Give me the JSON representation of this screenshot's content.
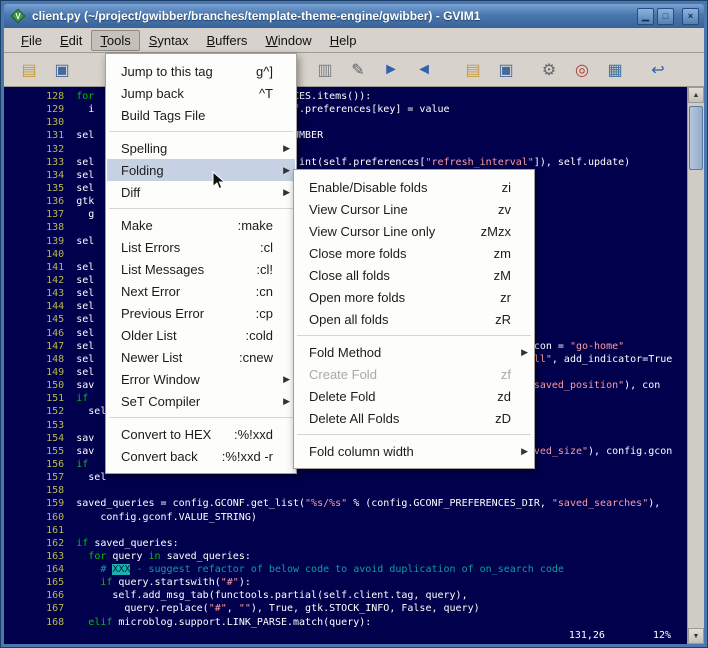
{
  "window": {
    "title": "client.py (~/project/gwibber/branches/template-theme-engine/gwibber) - GVIM1",
    "controls": [
      {
        "name": "minimize-button",
        "glyph": "▁"
      },
      {
        "name": "maximize-button",
        "glyph": "□"
      },
      {
        "name": "close-button",
        "glyph": "×"
      }
    ]
  },
  "colors": {
    "titlebar": "#4a78ae",
    "chrome": "#d7d3cc",
    "editor_bg": "#00004d",
    "normal_text": "#ffffff",
    "keyword": "#00c000",
    "string": "#ff9d9d",
    "comment": "#0e9e9e",
    "line_number": "#b9b94d",
    "xxx_highlight_bg": "#18b2b2",
    "menu_highlight": "#c6d2e4"
  },
  "menubar": {
    "items": [
      {
        "label": "File"
      },
      {
        "label": "Edit"
      },
      {
        "label": "Tools",
        "active": true
      },
      {
        "label": "Syntax"
      },
      {
        "label": "Buffers"
      },
      {
        "label": "Window"
      },
      {
        "label": "Help"
      }
    ]
  },
  "toolbar": {
    "buttons": [
      {
        "name": "open-file-icon",
        "glyph": "▤",
        "color": "#c79a3a"
      },
      {
        "name": "save-file-icon",
        "glyph": "▣",
        "color": "#46699c"
      },
      {
        "spacer": 230
      },
      {
        "name": "paste-icon",
        "glyph": "▥",
        "color": "#7a7f86"
      },
      {
        "name": "find-replace-icon",
        "glyph": "✎",
        "color": "#5b5f66"
      },
      {
        "name": "find-next-icon",
        "glyph": "►",
        "color": "#2f62ad"
      },
      {
        "name": "find-prev-icon",
        "glyph": "◄",
        "color": "#2f62ad"
      },
      {
        "spacer": 16
      },
      {
        "name": "load-session-icon",
        "glyph": "▤",
        "color": "#c79a3a"
      },
      {
        "name": "save-session-icon",
        "glyph": "▣",
        "color": "#46699c"
      },
      {
        "spacer": 10
      },
      {
        "name": "run-script-icon",
        "glyph": "⚙",
        "color": "#61666d"
      },
      {
        "name": "build-tags-icon",
        "glyph": "◎",
        "color": "#b23b2e"
      },
      {
        "name": "tag-jump-icon",
        "glyph": "▦",
        "color": "#3a6fa0"
      },
      {
        "spacer": 10
      },
      {
        "name": "help-icon",
        "glyph": "↩",
        "color": "#2f62ad"
      }
    ]
  },
  "menus": {
    "tools": {
      "items": [
        {
          "label": "Jump to this tag",
          "shortcut": "g^]"
        },
        {
          "label": "Jump back",
          "shortcut": "^T"
        },
        {
          "label": "Build Tags File"
        },
        {
          "sep": true
        },
        {
          "label": "Spelling",
          "submenu": true
        },
        {
          "label": "Folding",
          "submenu": true,
          "highlight": true
        },
        {
          "label": "Diff",
          "submenu": true
        },
        {
          "sep": true
        },
        {
          "label": "Make",
          "shortcut": ":make"
        },
        {
          "label": "List Errors",
          "shortcut": ":cl"
        },
        {
          "label": "List Messages",
          "shortcut": ":cl!"
        },
        {
          "label": "Next Error",
          "shortcut": ":cn"
        },
        {
          "label": "Previous Error",
          "shortcut": ":cp"
        },
        {
          "label": "Older List",
          "shortcut": ":cold"
        },
        {
          "label": "Newer List",
          "shortcut": ":cnew"
        },
        {
          "label": "Error Window",
          "submenu": true
        },
        {
          "label": "SeT Compiler",
          "submenu": true
        },
        {
          "sep": true
        },
        {
          "label": "Convert to HEX",
          "shortcut": ":%!xxd"
        },
        {
          "label": "Convert back",
          "shortcut": ":%!xxd -r"
        }
      ]
    },
    "folding": {
      "items": [
        {
          "label": "Enable/Disable folds",
          "shortcut": "zi"
        },
        {
          "label": "View Cursor Line",
          "shortcut": "zv"
        },
        {
          "label": "View Cursor Line only",
          "shortcut": "zMzx"
        },
        {
          "label": "Close more folds",
          "shortcut": "zm"
        },
        {
          "label": "Close all folds",
          "shortcut": "zM"
        },
        {
          "label": "Open more folds",
          "shortcut": "zr"
        },
        {
          "label": "Open all folds",
          "shortcut": "zR"
        },
        {
          "sep": true
        },
        {
          "label": "Fold Method",
          "submenu": true
        },
        {
          "label": "Create Fold",
          "shortcut": "zf",
          "disabled": true
        },
        {
          "label": "Delete Fold",
          "shortcut": "zd"
        },
        {
          "label": "Delete All Folds",
          "shortcut": "zD"
        },
        {
          "sep": true
        },
        {
          "label": "Fold column width",
          "submenu": true
        }
      ]
    }
  },
  "scrollbar": {
    "up": "▲",
    "down": "▼"
  },
  "editor": {
    "ruler": {
      "position": "131,26",
      "percent": "12%"
    },
    "lines": [
      {
        "num": 128,
        "segs": [
          {
            "c": "k",
            "t": "for"
          },
          {
            "c": "n",
            "t": "NCES.items()):",
            "col": 35
          }
        ]
      },
      {
        "num": 129,
        "segs": [
          {
            "c": "n",
            "t": "  i"
          },
          {
            "c": "n",
            "t": "lf.preferences[key] = value",
            "col": 35
          }
        ]
      },
      {
        "num": 130,
        "segs": []
      },
      {
        "num": 131,
        "segs": [
          {
            "c": "n",
            "t": "sel"
          },
          {
            "c": "n",
            "t": "NUMBER",
            "col": 35
          }
        ]
      },
      {
        "num": 132,
        "segs": []
      },
      {
        "num": 133,
        "segs": [
          {
            "c": "n",
            "t": "sel"
          },
          {
            "c": "n",
            "t": "* int(self.preferences[",
            "col": 35
          },
          {
            "c": "s",
            "t": "\"refresh_interval\""
          },
          {
            "c": "n",
            "t": "]), self.update)"
          }
        ]
      },
      {
        "num": 134,
        "segs": [
          {
            "c": "n",
            "t": "sel"
          }
        ]
      },
      {
        "num": 135,
        "segs": [
          {
            "c": "n",
            "t": "sel"
          }
        ]
      },
      {
        "num": 136,
        "segs": [
          {
            "c": "n",
            "t": "gtk"
          }
        ]
      },
      {
        "num": 137,
        "segs": [
          {
            "c": "n",
            "t": "  g"
          }
        ]
      },
      {
        "num": 138,
        "segs": []
      },
      {
        "num": 139,
        "segs": [
          {
            "c": "n",
            "t": "sel"
          }
        ]
      },
      {
        "num": 140,
        "segs": []
      },
      {
        "num": 141,
        "segs": [
          {
            "c": "n",
            "t": "sel"
          }
        ]
      },
      {
        "num": 142,
        "segs": [
          {
            "c": "n",
            "t": "sel"
          }
        ]
      },
      {
        "num": 143,
        "segs": [
          {
            "c": "n",
            "t": "sel"
          }
        ]
      },
      {
        "num": 144,
        "segs": [
          {
            "c": "n",
            "t": "sel"
          }
        ]
      },
      {
        "num": 145,
        "segs": [
          {
            "c": "n",
            "t": "sel"
          }
        ]
      },
      {
        "num": 146,
        "segs": [
          {
            "c": "n",
            "t": "sel"
          }
        ]
      },
      {
        "num": 147,
        "segs": [
          {
            "c": "n",
            "t": "sel"
          },
          {
            "c": "n",
            "t": "icon = ",
            "col": 75
          },
          {
            "c": "s",
            "t": "\"go-home\""
          }
        ]
      },
      {
        "num": 148,
        "segs": [
          {
            "c": "n",
            "t": "sel"
          },
          {
            "c": "s",
            "t": "all\"",
            "col": 75
          },
          {
            "c": "n",
            "t": ", add_indicator=True"
          }
        ]
      },
      {
        "num": 149,
        "segs": [
          {
            "c": "n",
            "t": "sel"
          }
        ]
      },
      {
        "num": 150,
        "segs": [
          {
            "c": "n",
            "t": "sav"
          },
          {
            "c": "s",
            "t": "\"saved_position\"",
            "col": 75
          },
          {
            "c": "n",
            "t": "), con"
          }
        ]
      },
      {
        "num": 151,
        "segs": [
          {
            "c": "k",
            "t": "if"
          }
        ]
      },
      {
        "num": 152,
        "segs": [
          {
            "c": "n",
            "t": "  sel"
          }
        ]
      },
      {
        "num": 153,
        "segs": []
      },
      {
        "num": 154,
        "segs": [
          {
            "c": "n",
            "t": "sav"
          }
        ]
      },
      {
        "num": 155,
        "segs": [
          {
            "c": "n",
            "t": "sav"
          },
          {
            "c": "s",
            "t": "aved_size\"",
            "col": 75
          },
          {
            "c": "n",
            "t": "), config.gcon"
          }
        ]
      },
      {
        "num": 156,
        "segs": [
          {
            "c": "k",
            "t": "if"
          }
        ]
      },
      {
        "num": 157,
        "segs": [
          {
            "c": "n",
            "t": "  sel"
          }
        ]
      },
      {
        "num": 158,
        "segs": []
      },
      {
        "num": 159,
        "segs": [
          {
            "c": "n",
            "t": "saved_queries = config.GCONF.get_list("
          },
          {
            "c": "s",
            "t": "\"%s/%s\""
          },
          {
            "c": "n",
            "t": " % (config.GCONF_PREFERENCES_DIR, "
          },
          {
            "c": "s",
            "t": "\"saved_searches\""
          },
          {
            "c": "n",
            "t": "),"
          }
        ]
      },
      {
        "num": 160,
        "segs": [
          {
            "c": "n",
            "t": "    config.gconf.VALUE_STRING)"
          }
        ]
      },
      {
        "num": 161,
        "segs": []
      },
      {
        "num": 162,
        "segs": [
          {
            "c": "k",
            "t": "if"
          },
          {
            "c": "n",
            "t": " saved_queries:"
          }
        ]
      },
      {
        "num": 163,
        "segs": [
          {
            "c": "n",
            "t": "  "
          },
          {
            "c": "k",
            "t": "for"
          },
          {
            "c": "n",
            "t": " query "
          },
          {
            "c": "k",
            "t": "in"
          },
          {
            "c": "n",
            "t": " saved_queries:"
          }
        ]
      },
      {
        "num": 164,
        "segs": [
          {
            "c": "c",
            "t": "    # "
          },
          {
            "c": "x",
            "t": "XXX"
          },
          {
            "c": "c",
            "t": " - suggest refactor of below code to avoid duplication of on_search code"
          }
        ]
      },
      {
        "num": 165,
        "segs": [
          {
            "c": "n",
            "t": "    "
          },
          {
            "c": "k",
            "t": "if"
          },
          {
            "c": "n",
            "t": " query.startswith("
          },
          {
            "c": "s",
            "t": "\"#\""
          },
          {
            "c": "n",
            "t": "):"
          }
        ]
      },
      {
        "num": 166,
        "segs": [
          {
            "c": "n",
            "t": "      self.add_msg_tab(functools.partial(self.client.tag, query),"
          }
        ]
      },
      {
        "num": 167,
        "segs": [
          {
            "c": "n",
            "t": "        query.replace("
          },
          {
            "c": "s",
            "t": "\"#\""
          },
          {
            "c": "n",
            "t": ", "
          },
          {
            "c": "s",
            "t": "\"\""
          },
          {
            "c": "n",
            "t": "), True, gtk.STOCK_INFO, False, query)"
          }
        ]
      },
      {
        "num": 168,
        "segs": [
          {
            "c": "n",
            "t": "  "
          },
          {
            "c": "k",
            "t": "elif"
          },
          {
            "c": "n",
            "t": " microblog.support.LINK_PARSE.match(query):"
          }
        ]
      }
    ]
  }
}
